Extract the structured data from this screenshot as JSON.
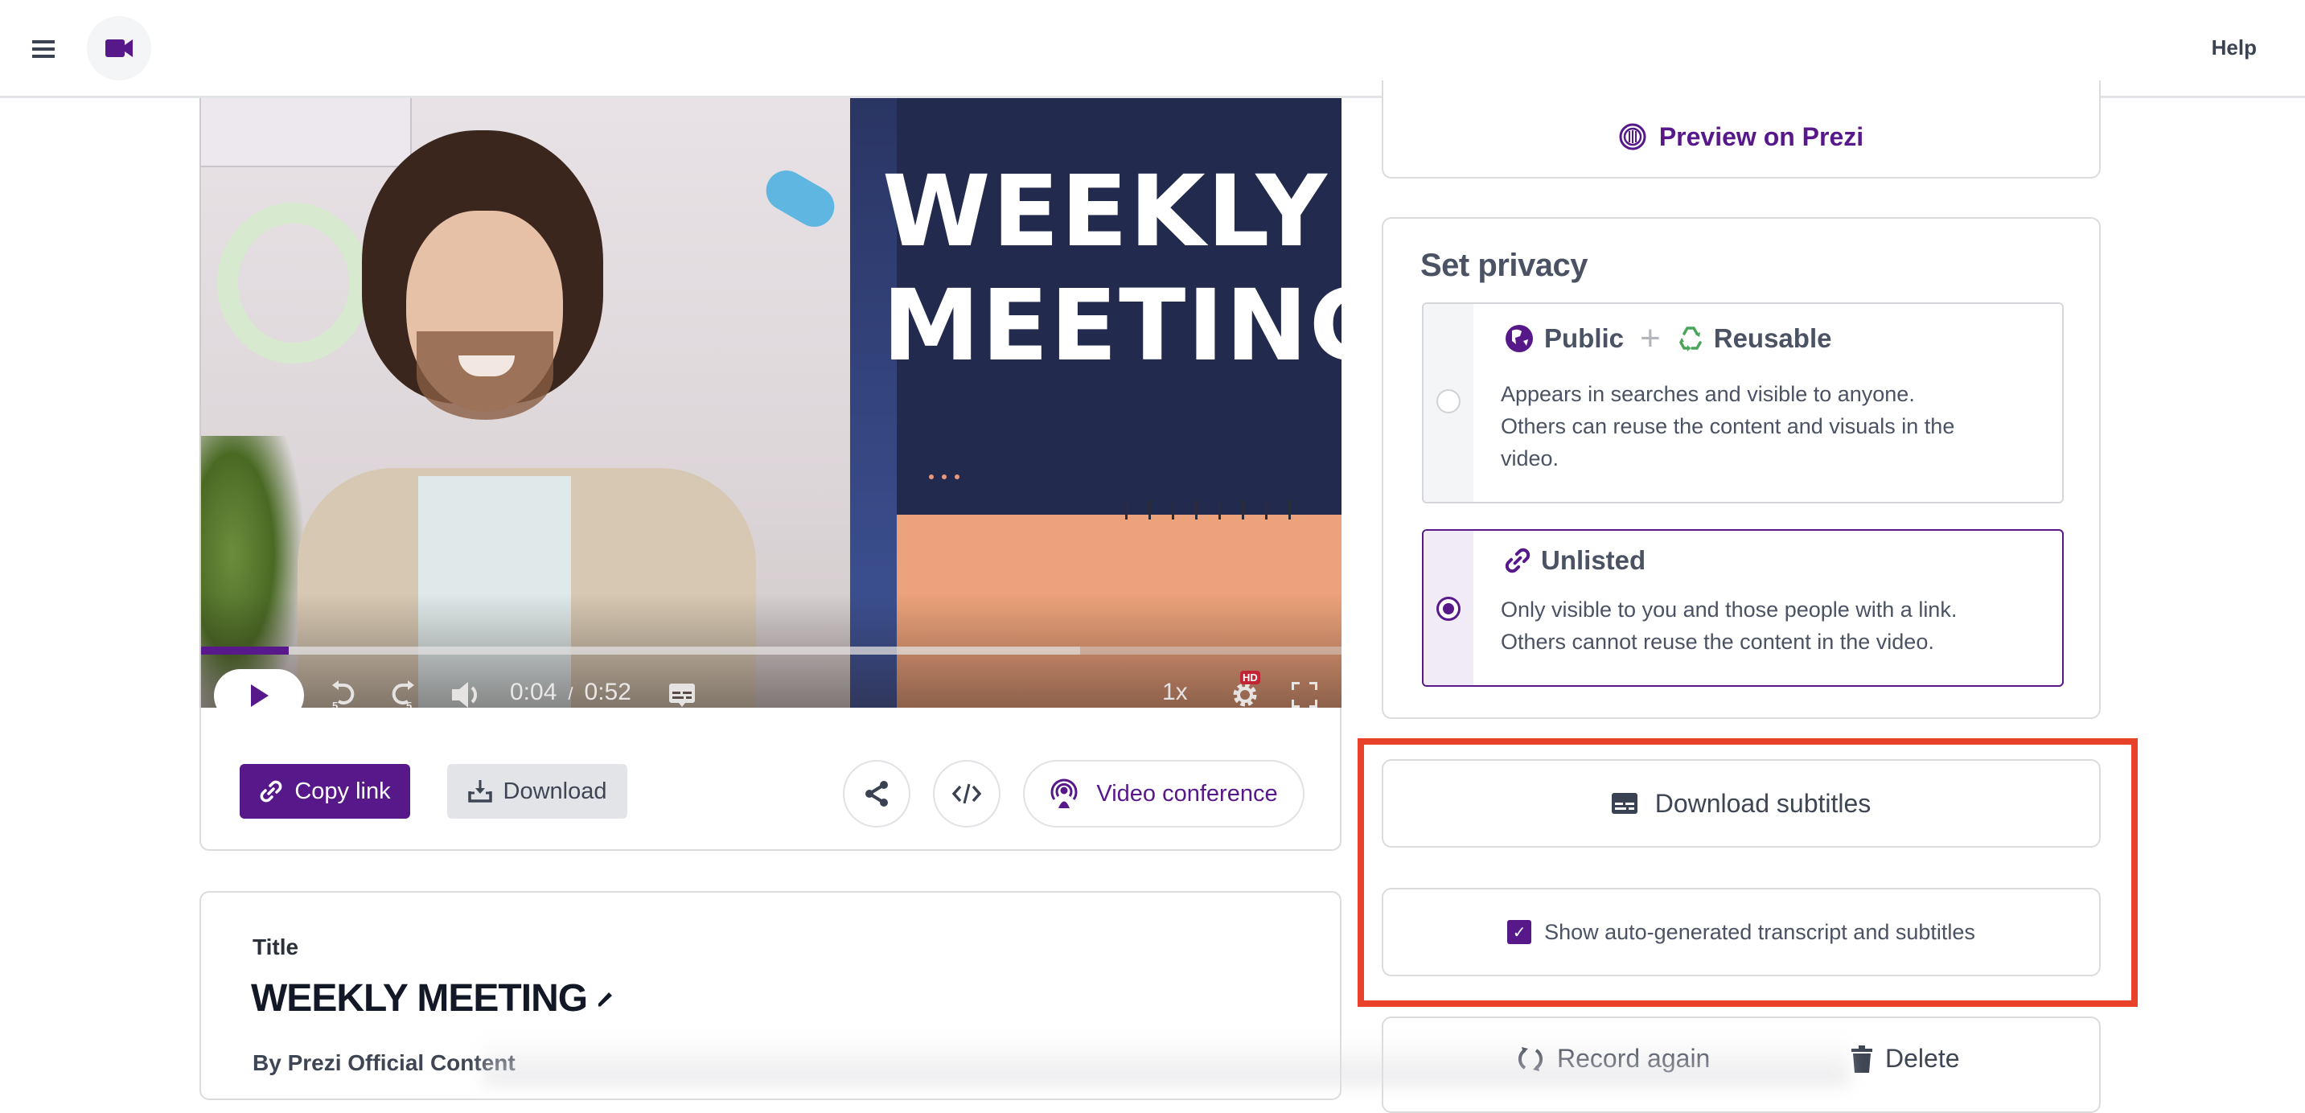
{
  "header": {
    "menu_icon": "hamburger-icon",
    "logo_icon": "video-camera-icon",
    "help_label": "Help"
  },
  "video": {
    "art_title_line1": "WEEKLY",
    "art_title_line2": "MEETING",
    "current_time": "0:04",
    "separator": "/",
    "duration": "0:52",
    "progress_fraction": 0.077,
    "buffered_fraction": 0.77,
    "speed": "1x",
    "quality_badge": "HD",
    "controls": [
      "play",
      "rewind-5",
      "forward-5",
      "volume",
      "captions",
      "speed",
      "settings",
      "fullscreen"
    ],
    "rewind_label": "5",
    "forward_label": "5"
  },
  "actions": {
    "copy_link": "Copy link",
    "download": "Download",
    "video_conference": "Video conference"
  },
  "details": {
    "title_label": "Title",
    "title_value": "WEEKLY MEETING",
    "author": "By Prezi Official Content"
  },
  "sidebar": {
    "preview_label": "Preview on Prezi",
    "privacy_title": "Set privacy",
    "options": [
      {
        "label": "Public",
        "label2": "Reusable",
        "desc_line1": "Appears in searches and visible to anyone.",
        "desc_line2": "Others can reuse the content and visuals in the",
        "desc_line3": "video.",
        "selected": false
      },
      {
        "label": "Unlisted",
        "desc_line1": "Only visible to you and those people with a link.",
        "desc_line2": "Others cannot reuse the content in the video.",
        "selected": true
      }
    ],
    "download_subtitles": "Download subtitles",
    "show_transcript_label": "Show auto-generated transcript and subtitles",
    "show_transcript_checked": true,
    "record_again": "Record again",
    "delete": "Delete"
  },
  "colors": {
    "brand_purple": "#571889",
    "highlight_red": "#e8432a",
    "hd_badge": "#c12637",
    "recycle_green": "#4aa55a"
  }
}
